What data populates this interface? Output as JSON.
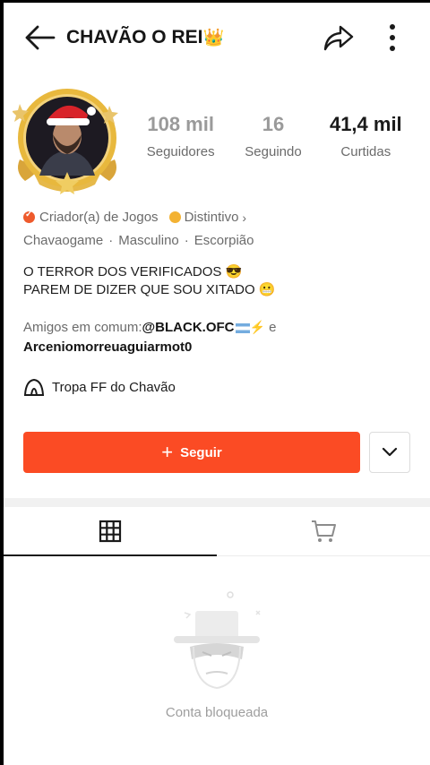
{
  "header": {
    "title": "CHAVÃO O REI",
    "title_emoji": "👑",
    "icons": {
      "back": "arrow-left-icon",
      "share": "share-arrow-icon",
      "more": "more-vertical-icon"
    }
  },
  "profile": {
    "stats": [
      {
        "value": "108 mil",
        "label": "Seguidores"
      },
      {
        "value": "16",
        "label": "Seguindo"
      },
      {
        "value": "41,4 mil",
        "label": "Curtidas"
      }
    ],
    "badges": {
      "creator": "Criador(a) de Jogos",
      "distinction": "Distintivo"
    },
    "meta": [
      "Chavaogame",
      "Masculino",
      "Escorpião"
    ],
    "bio_lines": [
      "O TERROR DOS VERIFICADOS 😎",
      "PAREM DE DIZER QUE SOU XITADO 😬"
    ],
    "mutual": {
      "prefix": "Amigos em comum:",
      "friend1": "@BLACK.OFC",
      "connector": "e",
      "friend2": "Arceniomorreuaguiarmot0"
    },
    "group": "Tropa FF do Chavão"
  },
  "actions": {
    "follow": "Seguir"
  },
  "tabs": [
    "grid-icon",
    "cart-icon"
  ],
  "empty_state": {
    "text": "Conta bloqueada"
  },
  "colors": {
    "accent": "#fb4b24",
    "creator_badge": "#ee5a2c",
    "coin": "#f3b233"
  }
}
